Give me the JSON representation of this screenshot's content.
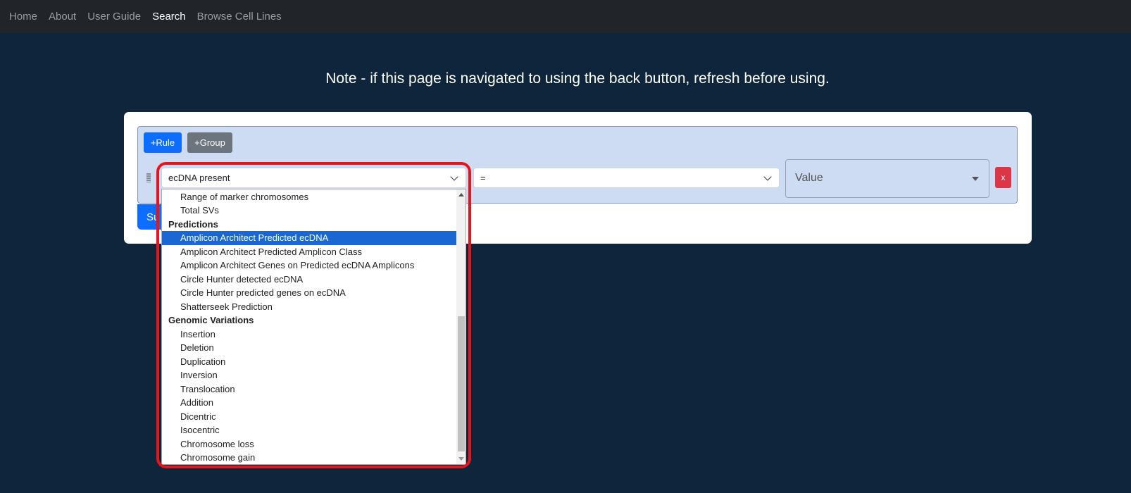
{
  "nav": {
    "items": [
      {
        "label": "Home"
      },
      {
        "label": "About"
      },
      {
        "label": "User Guide"
      },
      {
        "label": "Search",
        "active": true
      },
      {
        "label": "Browse Cell Lines"
      }
    ]
  },
  "note": "Note - if this page is navigated to using the back button, refresh before using.",
  "builder": {
    "add_rule": "+Rule",
    "add_group": "+Group",
    "submit": "Su",
    "field_value": "ecDNA present",
    "operator_value": "=",
    "value_placeholder": "Value",
    "delete": "x"
  },
  "dropdown": {
    "selected": "Amplicon Architect Predicted ecDNA",
    "items": [
      {
        "label": "Range of marker chromosomes"
      },
      {
        "label": "Total SVs"
      },
      {
        "label": "Predictions",
        "header": true
      },
      {
        "label": "Amplicon Architect Predicted ecDNA"
      },
      {
        "label": "Amplicon Architect Predicted Amplicon Class"
      },
      {
        "label": "Amplicon Architect Genes on Predicted ecDNA Amplicons"
      },
      {
        "label": "Circle Hunter detected ecDNA"
      },
      {
        "label": "Circle Hunter predicted genes on ecDNA"
      },
      {
        "label": "Shatterseek Prediction"
      },
      {
        "label": "Genomic Variations",
        "header": true
      },
      {
        "label": "Insertion"
      },
      {
        "label": "Deletion"
      },
      {
        "label": "Duplication"
      },
      {
        "label": "Inversion"
      },
      {
        "label": "Translocation"
      },
      {
        "label": "Addition"
      },
      {
        "label": "Dicentric"
      },
      {
        "label": "Isocentric"
      },
      {
        "label": "Chromosome loss"
      },
      {
        "label": "Chromosome gain"
      }
    ]
  },
  "colors": {
    "primary": "#0d6efd",
    "secondary": "#6c757d",
    "danger": "#dc3545",
    "highlight": "#e8141c",
    "background": "#0f253b"
  }
}
